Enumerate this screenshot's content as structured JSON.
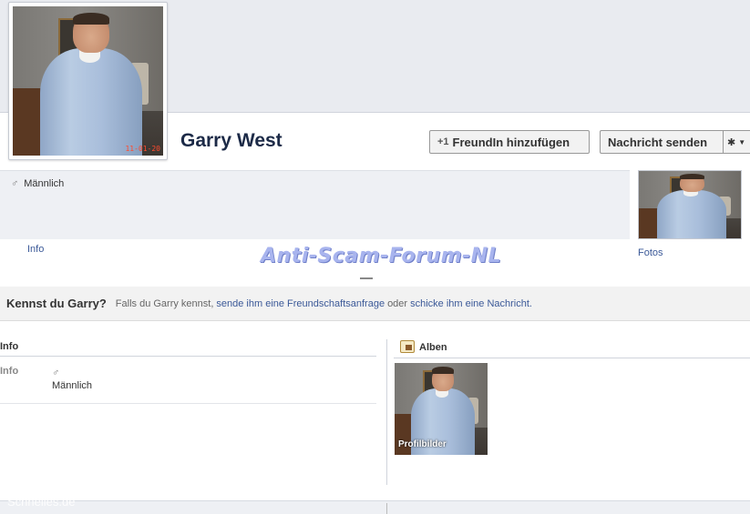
{
  "profile": {
    "name": "Garry West",
    "photo_date_stamp": "11-01-20",
    "gender": "Männlich"
  },
  "actions": {
    "add_friend_label": "FreundIn hinzufügen",
    "add_friend_prefix": "+1",
    "send_message_label": "Nachricht senden",
    "settings_icon": "gear-icon"
  },
  "links": {
    "info": "Info",
    "fotos": "Fotos"
  },
  "watermark": "Anti-Scam-Forum-NL",
  "kennst": {
    "title": "Kennst du Garry?",
    "text_before": "Falls du Garry kennst,",
    "link1": "sende ihm eine Freundschaftsanfrage",
    "middle": "oder",
    "link2": "schicke ihm eine Nachricht."
  },
  "info_section": {
    "heading": "Info",
    "row_label": "Info",
    "row_value": "Männlich"
  },
  "albums_section": {
    "heading": "Alben",
    "album_name": "Profilbilder"
  },
  "footer_mark": "Schnelles.de"
}
